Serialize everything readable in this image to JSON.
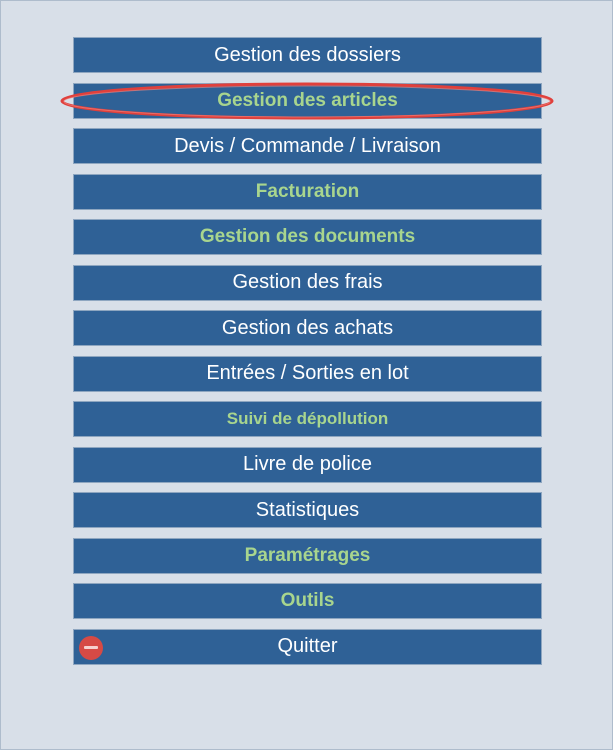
{
  "menu": {
    "items": [
      {
        "label": "Gestion des dossiers",
        "name": "gestion-dossiers-button",
        "bold": false
      },
      {
        "label": "Gestion des articles",
        "name": "gestion-articles-button",
        "bold": true
      },
      {
        "label": "Devis / Commande / Livraison",
        "name": "devis-commande-livraison-button",
        "bold": false
      },
      {
        "label": "Facturation",
        "name": "facturation-button",
        "bold": true
      },
      {
        "label": "Gestion des documents",
        "name": "gestion-documents-button",
        "bold": true
      },
      {
        "label": "Gestion des frais",
        "name": "gestion-frais-button",
        "bold": false
      },
      {
        "label": "Gestion des achats",
        "name": "gestion-achats-button",
        "bold": false
      },
      {
        "label": "Entrées / Sorties en lot",
        "name": "entrees-sorties-lot-button",
        "bold": false
      },
      {
        "label": "Suivi de dépollution",
        "name": "suivi-depollution-button",
        "bold": true
      },
      {
        "label": "Livre de police",
        "name": "livre-police-button",
        "bold": false
      },
      {
        "label": "Statistiques",
        "name": "statistiques-button",
        "bold": false
      },
      {
        "label": "Paramétrages",
        "name": "parametrages-button",
        "bold": true
      },
      {
        "label": "Outils",
        "name": "outils-button",
        "bold": true
      },
      {
        "label": "Quitter",
        "name": "quitter-button",
        "bold": false,
        "icon": "no-entry-icon"
      }
    ]
  },
  "colors": {
    "button_bg": "#2f6196",
    "bold_text": "#a8d58e",
    "highlight": "#e0403c",
    "quit_icon": "#d64a45"
  }
}
